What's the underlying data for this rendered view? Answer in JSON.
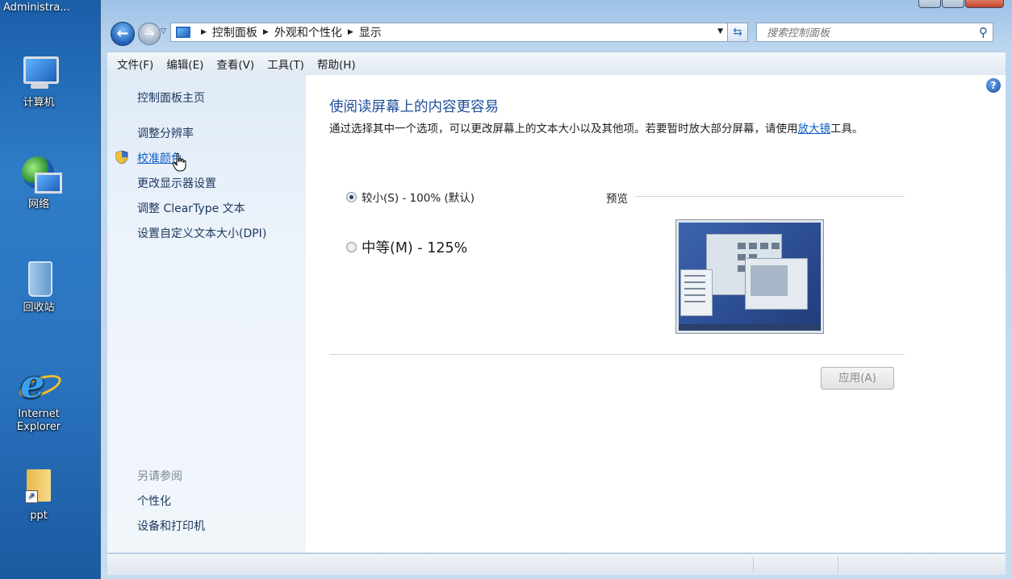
{
  "desktop": {
    "user_label": "Administra...",
    "icons": [
      {
        "label": "计算机",
        "icon": "computer-icon"
      },
      {
        "label": "网络",
        "icon": "network-icon"
      },
      {
        "label": "回收站",
        "icon": "recycle-bin-icon"
      },
      {
        "label": "Internet Explorer",
        "icon": "internet-explorer-icon"
      },
      {
        "label": "ppt",
        "icon": "folder-shortcut-icon"
      }
    ]
  },
  "window": {
    "address": {
      "crumbs": [
        "控制面板",
        "外观和个性化",
        "显示"
      ]
    },
    "search": {
      "placeholder": "搜索控制面板"
    },
    "menu": [
      "文件(F)",
      "编辑(E)",
      "查看(V)",
      "工具(T)",
      "帮助(H)"
    ],
    "sidebar": {
      "links": [
        "控制面板主页",
        "调整分辨率",
        "校准颜色",
        "更改显示器设置",
        "调整 ClearType 文本",
        "设置自定义文本大小(DPI)"
      ],
      "see_also_heading": "另请参阅",
      "see_also": [
        "个性化",
        "设备和打印机"
      ]
    },
    "main": {
      "title": "使阅读屏幕上的内容更容易",
      "description_pre": "通过选择其中一个选项，可以更改屏幕上的文本大小以及其他项。若要暂时放大部分屏幕，请使用",
      "description_link": "放大镜",
      "description_post": "工具。",
      "options": [
        {
          "label": "较小(S) - 100% (默认)",
          "selected": true
        },
        {
          "label": "中等(M) - 125%",
          "selected": false
        }
      ],
      "preview_label": "预览",
      "apply_label": "应用(A)"
    }
  }
}
